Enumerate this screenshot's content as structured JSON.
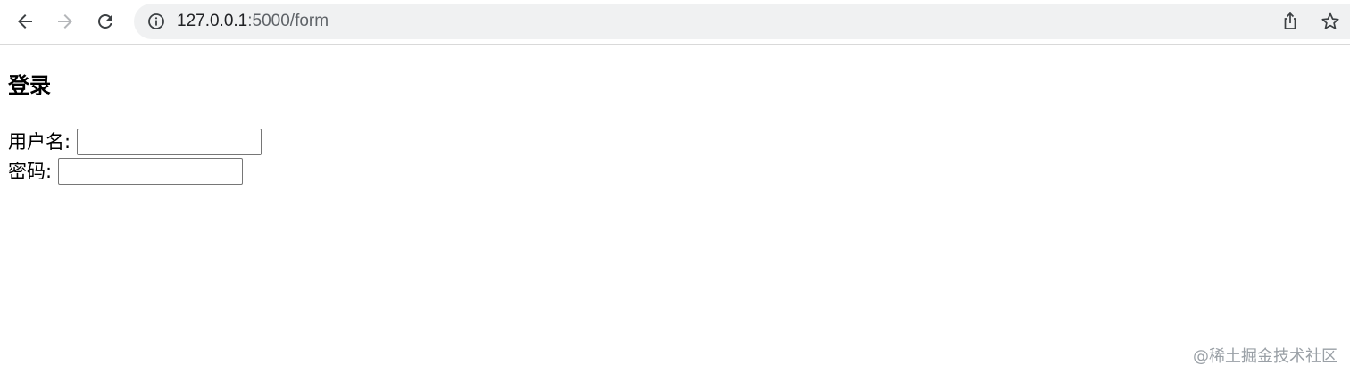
{
  "browser": {
    "url_host": "127.0.0.1",
    "url_path": ":5000/form",
    "back_label": "Back",
    "forward_label": "Forward",
    "reload_label": "Reload"
  },
  "page": {
    "title": "登录",
    "username_label": "用户名:",
    "username_value": "",
    "password_label": "密码:",
    "password_value": ""
  },
  "watermark": "@稀土掘金技术社区",
  "colors": {
    "toolbar_bg": "#ffffff",
    "omnibox_bg": "#f0f1f2",
    "icon_color": "#5f6368",
    "forward_disabled": "#b4b6b9"
  }
}
